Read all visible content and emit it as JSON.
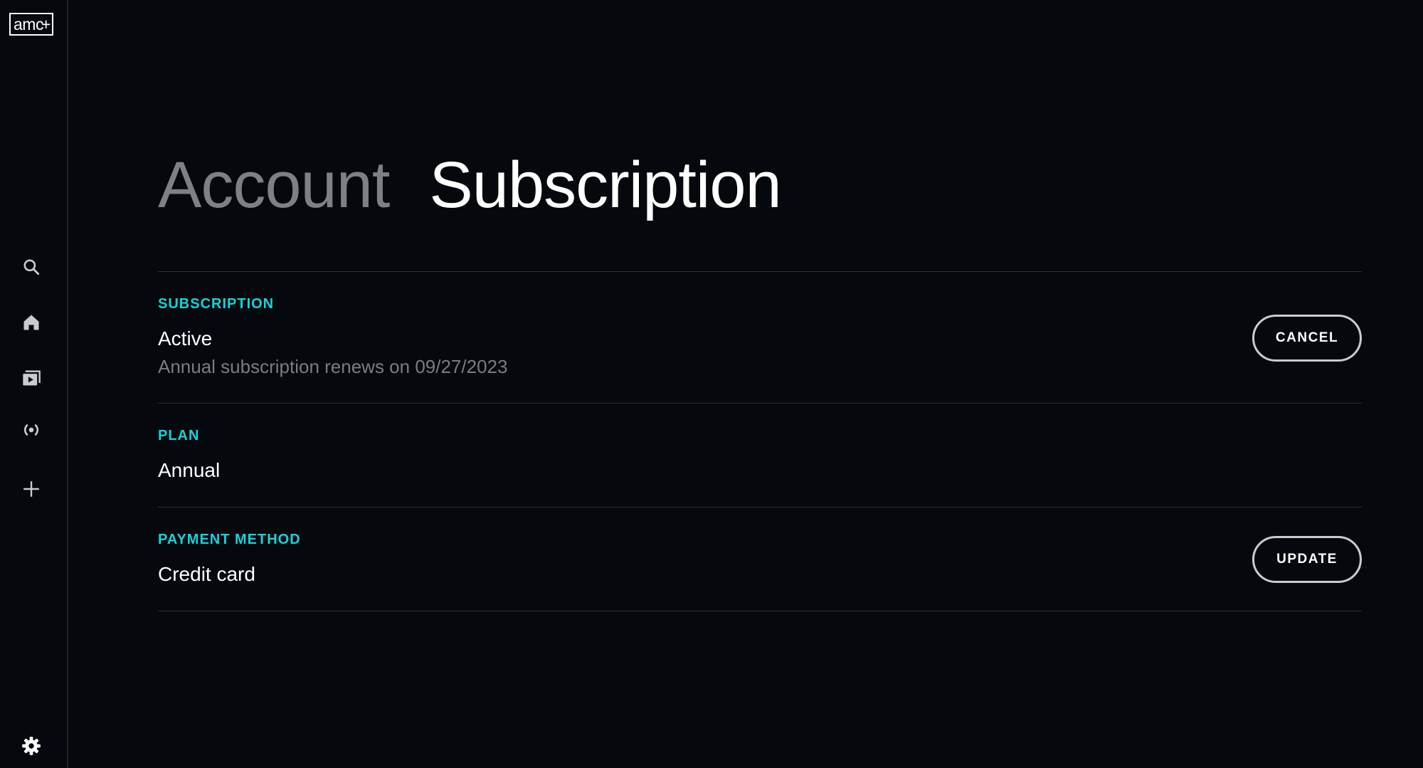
{
  "app": {
    "logo_text": "amc",
    "logo_plus": "+"
  },
  "sidebar": {
    "items": [
      {
        "name": "search",
        "icon": "search-icon"
      },
      {
        "name": "home",
        "icon": "home-icon"
      },
      {
        "name": "library",
        "icon": "media-library-icon"
      },
      {
        "name": "live",
        "icon": "broadcast-icon"
      },
      {
        "name": "add",
        "icon": "plus-icon"
      },
      {
        "name": "settings",
        "icon": "gear-icon"
      }
    ]
  },
  "tabs": [
    {
      "label": "Account",
      "active": false
    },
    {
      "label": "Subscription",
      "active": true
    }
  ],
  "sections": {
    "subscription": {
      "label": "SUBSCRIPTION",
      "value": "Active",
      "detail": "Annual subscription renews on 09/27/2023",
      "button": "CANCEL"
    },
    "plan": {
      "label": "PLAN",
      "value": "Annual"
    },
    "payment": {
      "label": "PAYMENT METHOD",
      "value": "Credit card",
      "button": "UPDATE"
    }
  },
  "colors": {
    "background": "#05080d",
    "accent": "#15d4db",
    "text_primary": "#ffffff",
    "text_muted": "#7a7d80"
  }
}
